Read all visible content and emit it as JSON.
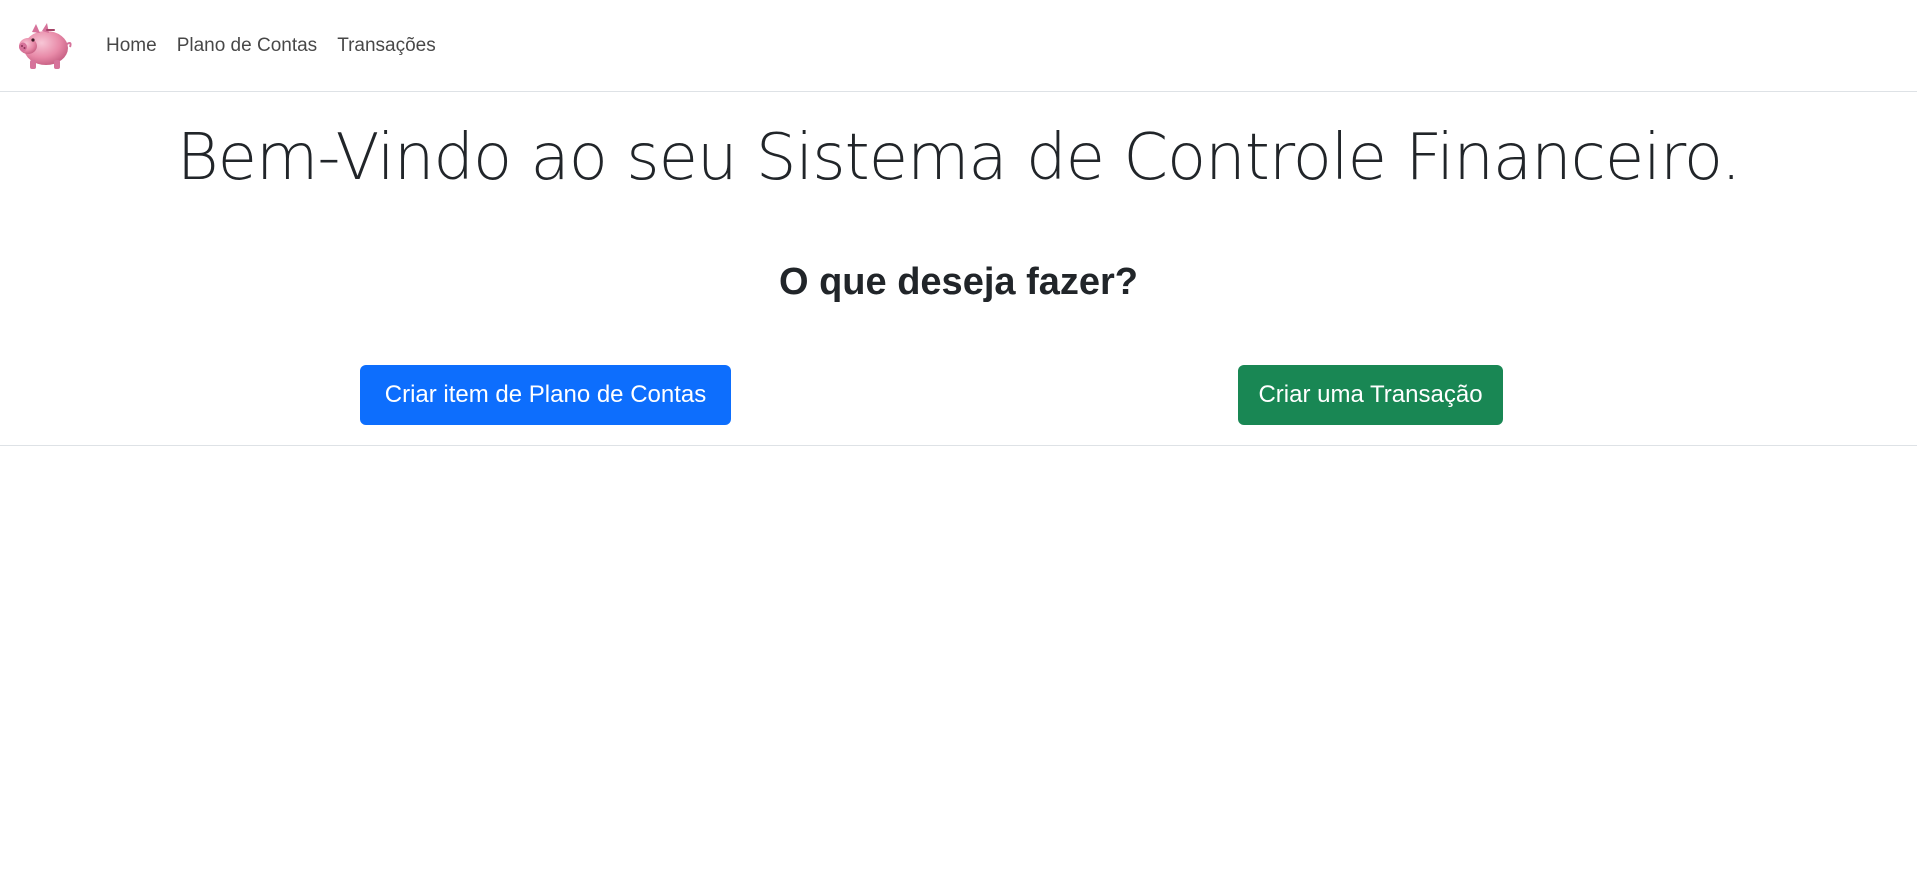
{
  "navbar": {
    "logo_icon": "piggy-bank-icon",
    "links": [
      {
        "label": "Home"
      },
      {
        "label": "Plano de Contas"
      },
      {
        "label": "Transações"
      }
    ]
  },
  "main": {
    "headline": "Bem-Vindo ao seu Sistema de Controle Financeiro.",
    "subheading": "O que deseja fazer?",
    "actions": {
      "create_account_plan": "Criar item de Plano de Contas",
      "create_transaction": "Criar uma Transação"
    }
  },
  "colors": {
    "primary": "#0d6efd",
    "success": "#198754",
    "text": "#212529",
    "border": "#dee2e6",
    "piggy_pink": "#e88aa8"
  }
}
